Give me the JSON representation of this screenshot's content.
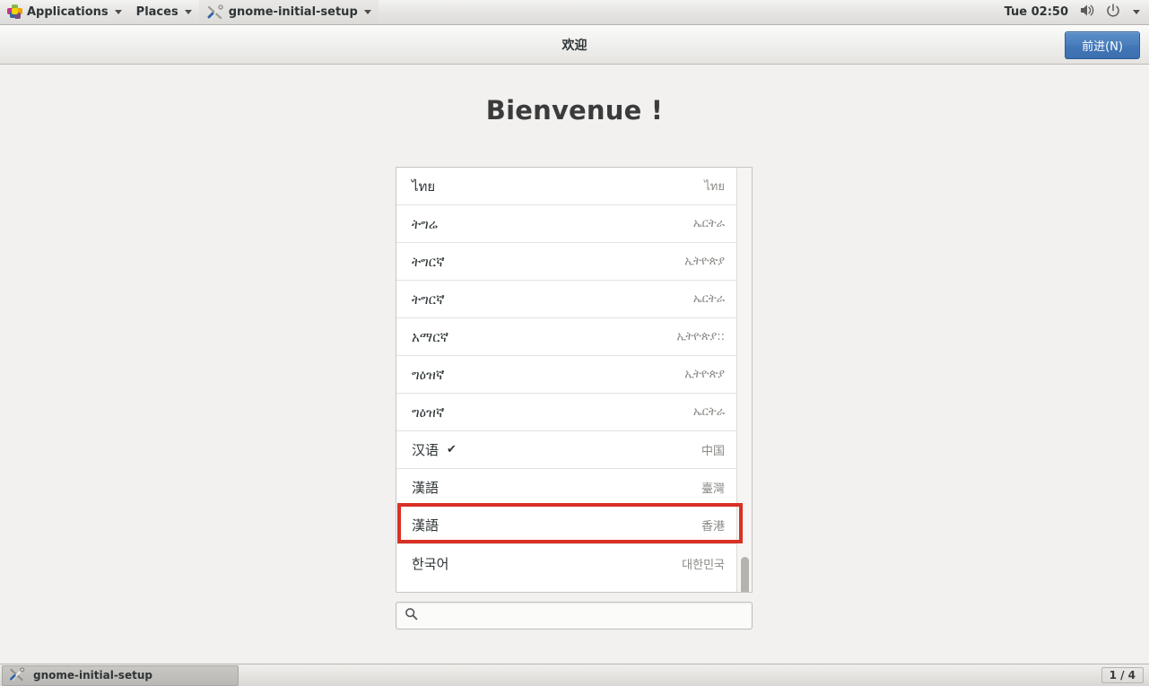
{
  "top_panel": {
    "applications_label": "Applications",
    "places_label": "Places",
    "active_window_label": "gnome-initial-setup",
    "clock": "Tue 02:50",
    "icons": {
      "menu": "gnome-logo-icon",
      "app": "tool-icon",
      "volume": "volume-icon",
      "power": "power-icon",
      "caret": "chevron-down-icon"
    }
  },
  "headerbar": {
    "title": "欢迎",
    "next_label": "前进(N)"
  },
  "main": {
    "welcome_title": "Bienvenue !",
    "languages": [
      {
        "name": "ไทย",
        "region": "ไทย",
        "selected": false
      },
      {
        "name": "ትግሬ",
        "region": "ኤርትራ",
        "selected": false
      },
      {
        "name": "ትግርኛ",
        "region": "ኢትዮጵያ",
        "selected": false
      },
      {
        "name": "ትግርኛ",
        "region": "ኤርትራ",
        "selected": false
      },
      {
        "name": "አማርኛ",
        "region": "ኢትዮጵያ::",
        "selected": false
      },
      {
        "name": "ግዕዝኛ",
        "region": "ኢትዮጵያ",
        "selected": false
      },
      {
        "name": "ግዕዝኛ",
        "region": "ኤርትራ",
        "selected": false
      },
      {
        "name": "汉语",
        "region": "中国",
        "selected": true
      },
      {
        "name": "漢語",
        "region": "臺灣",
        "selected": false
      },
      {
        "name": "漢語",
        "region": "香港",
        "selected": false
      },
      {
        "name": "한국어",
        "region": "대한민국",
        "selected": false
      }
    ],
    "selected_check_glyph": "✔",
    "search": {
      "value": "",
      "placeholder": "",
      "icon": "search-icon"
    },
    "highlight_color": "#d93025"
  },
  "bottom_panel": {
    "task_label": "gnome-initial-setup",
    "workspace_indicator": "1 / 4"
  }
}
